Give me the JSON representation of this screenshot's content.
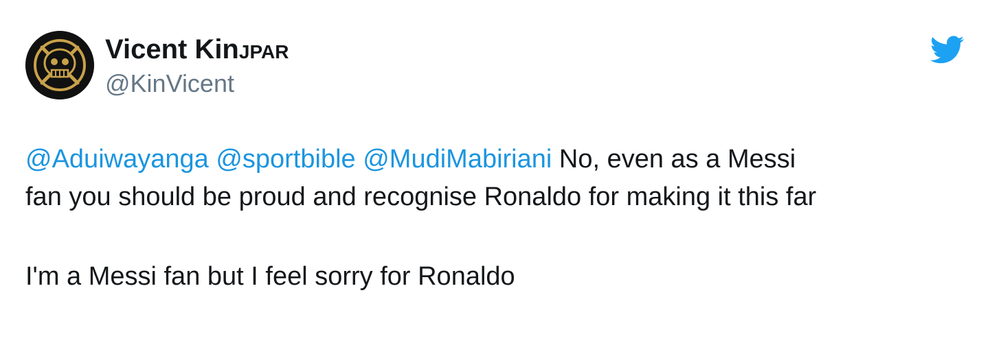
{
  "tweet": {
    "author": {
      "display_name": "Vicent Kin",
      "name_suffix": "JPAR",
      "handle": "@KinVicent"
    },
    "mentions": [
      "@Aduiwayanga",
      "@sportbible",
      "@MudiMabiriani"
    ],
    "text_line1_rest": "No, even as a Messi",
    "text_line2": "fan you should be proud and recognise Ronaldo for making it this far",
    "text_paragraph2": "I'm a Messi fan but I feel sorry for Ronaldo"
  },
  "icons": {
    "brand": "twitter-bird-icon",
    "avatar": "jolly-roger-avatar"
  },
  "colors": {
    "mention": "#1b95e0",
    "handle": "#657786",
    "text": "#14171a",
    "brand": "#1da1f2"
  }
}
